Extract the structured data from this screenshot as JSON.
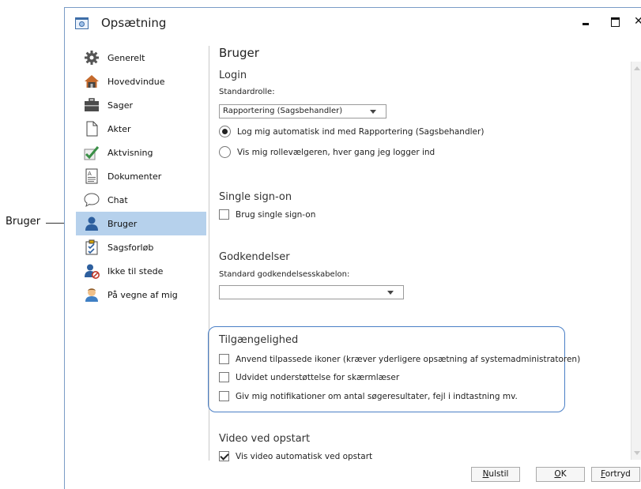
{
  "callout": {
    "label": "Bruger"
  },
  "window": {
    "title": "Opsætning",
    "close_glyph": "✕"
  },
  "sidebar": {
    "items": [
      {
        "label": "Generelt",
        "icon": "gear-icon"
      },
      {
        "label": "Hovedvindue",
        "icon": "house-icon"
      },
      {
        "label": "Sager",
        "icon": "briefcase-icon"
      },
      {
        "label": "Akter",
        "icon": "document-icon"
      },
      {
        "label": "Aktvisning",
        "icon": "checkmark-icon"
      },
      {
        "label": "Dokumenter",
        "icon": "text-document-icon"
      },
      {
        "label": "Chat",
        "icon": "speech-bubble-icon"
      },
      {
        "label": "Bruger",
        "icon": "user-icon",
        "active": true
      },
      {
        "label": "Sagsforløb",
        "icon": "clipboard-checklist-icon"
      },
      {
        "label": "Ikke til stede",
        "icon": "user-away-icon"
      },
      {
        "label": "På vegne af mig",
        "icon": "user-avatar-icon"
      }
    ]
  },
  "content": {
    "title": "Bruger",
    "login": {
      "heading": "Login",
      "role_label": "Standardrolle:",
      "role_value": "Rapportering (Sagsbehandler)",
      "radio_auto": "Log mig automatisk ind med Rapportering (Sagsbehandler)",
      "radio_selector": "Vis mig rollevælgeren, hver gang jeg logger ind"
    },
    "sso": {
      "heading": "Single sign-on",
      "checkbox": "Brug single sign-on"
    },
    "approvals": {
      "heading": "Godkendelser",
      "template_label": "Standard godkendelsesskabelon:",
      "template_value": ""
    },
    "accessibility": {
      "heading": "Tilgængelighed",
      "custom_icons": "Anvend tilpassede ikoner (kræver yderligere opsætning af systemadministratoren)",
      "screen_reader": "Udvidet understøttelse for skærmlæser",
      "notifications": "Giv mig notifikationer om antal søgeresultater, fejl i indtastning mv."
    },
    "video": {
      "heading": "Video ved opstart",
      "checkbox": "Vis video automatisk ved opstart"
    }
  },
  "footer": {
    "reset_accel": "N",
    "reset_rest": "ulstil",
    "ok_accel": "O",
    "ok_rest": "K",
    "undo_accel": "F",
    "undo_rest": "ortryd"
  },
  "colors": {
    "active_item": "#b6d1ec",
    "highlight_border": "#4a7fc6",
    "window_border": "#7a9cc6"
  }
}
